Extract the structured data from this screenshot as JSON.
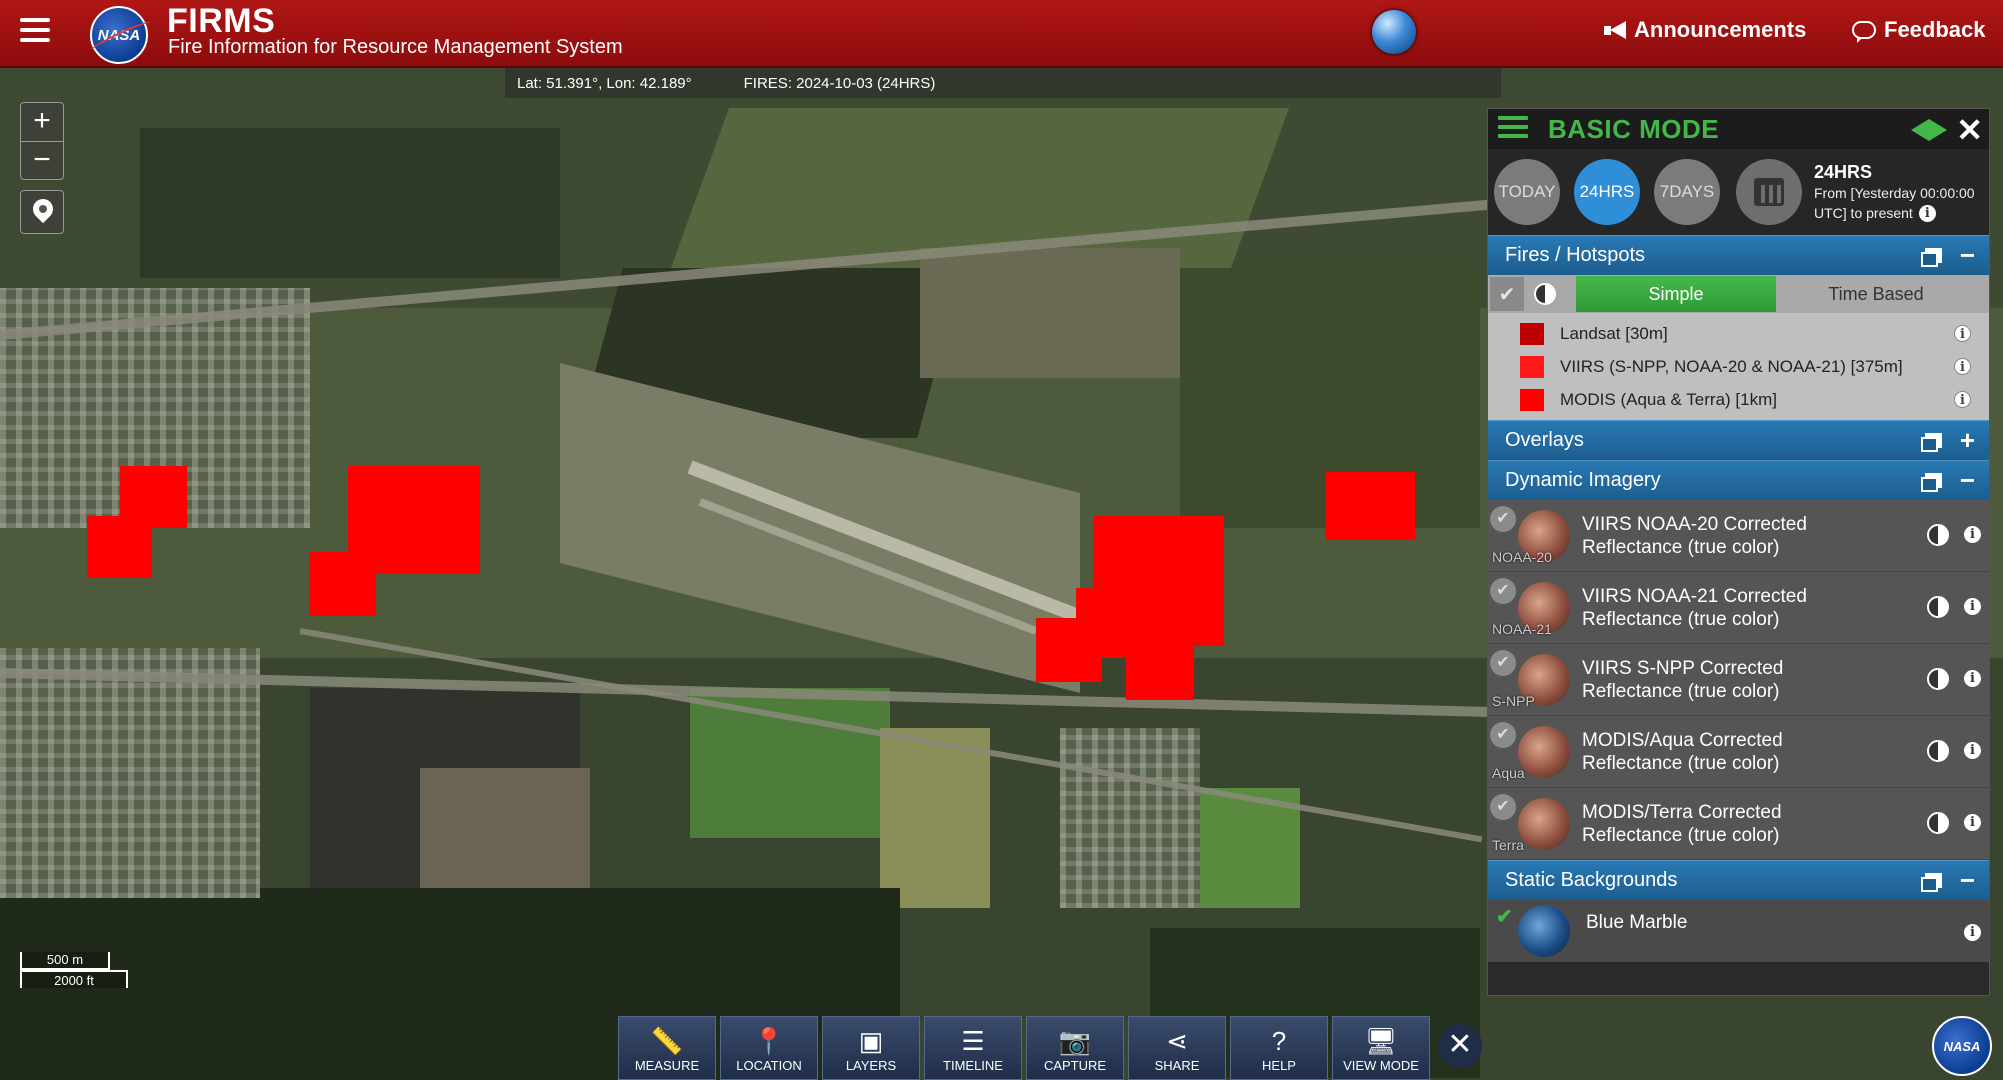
{
  "header": {
    "title": "FIRMS",
    "subtitle": "Fire Information for Resource Management System",
    "nasa_logo_text": "NASA",
    "announcements_label": "Announcements",
    "feedback_label": "Feedback"
  },
  "map": {
    "coordinates": "Lat: 51.391°, Lon: 42.189°",
    "fires_info": "FIRES: 2024-10-03 (24HRS)",
    "zoom_in": "+",
    "zoom_out": "−",
    "scale_metric": "500 m",
    "scale_imperial": "2000 ft"
  },
  "toolbar": {
    "measure": "MEASURE",
    "location": "LOCATION",
    "layers": "LAYERS",
    "timeline": "TIMELINE",
    "capture": "CAPTURE",
    "share": "SHARE",
    "help": "HELP",
    "view_mode": "VIEW MODE"
  },
  "panel": {
    "mode_title": "BASIC MODE",
    "time_buttons": [
      "TODAY",
      "24HRS",
      "7DAYS"
    ],
    "active_time": "24HRS",
    "time_title": "24HRS",
    "time_range_line1": "From [Yesterday 00:00:00",
    "time_range_line2": "UTC] to present",
    "sections": {
      "fires": "Fires / Hotspots",
      "overlays": "Overlays",
      "dynamic": "Dynamic Imagery",
      "static": "Static Backgrounds"
    },
    "fire_modes": {
      "simple": "Simple",
      "time_based": "Time Based"
    },
    "fire_legend": [
      {
        "label": "Landsat [30m]",
        "color": "#c00000"
      },
      {
        "label": "VIIRS (S-NPP, NOAA-20 & NOAA-21) [375m]",
        "color": "#ff1a1a"
      },
      {
        "label": "MODIS (Aqua & Terra) [1km]",
        "color": "#ff0000"
      }
    ],
    "dynamic_imagery": [
      {
        "tag": "NOAA-20",
        "line1": "VIIRS NOAA-20 Corrected",
        "line2": "Reflectance (true color)"
      },
      {
        "tag": "NOAA-21",
        "line1": "VIIRS NOAA-21 Corrected",
        "line2": "Reflectance (true color)"
      },
      {
        "tag": "S-NPP",
        "line1": "VIIRS S-NPP Corrected",
        "line2": "Reflectance (true color)"
      },
      {
        "tag": "Aqua",
        "line1": "MODIS/Aqua Corrected",
        "line2": "Reflectance (true color)"
      },
      {
        "tag": "Terra",
        "line1": "MODIS/Terra Corrected",
        "line2": "Reflectance (true color)"
      }
    ],
    "static_backgrounds": [
      {
        "label": "Blue Marble"
      }
    ]
  },
  "colors": {
    "header_red": "#b01616",
    "accent_green": "#41b848",
    "section_blue": "#2979b5",
    "active_blue": "#2f8ed8",
    "hotspot_red": "#ff0000"
  }
}
